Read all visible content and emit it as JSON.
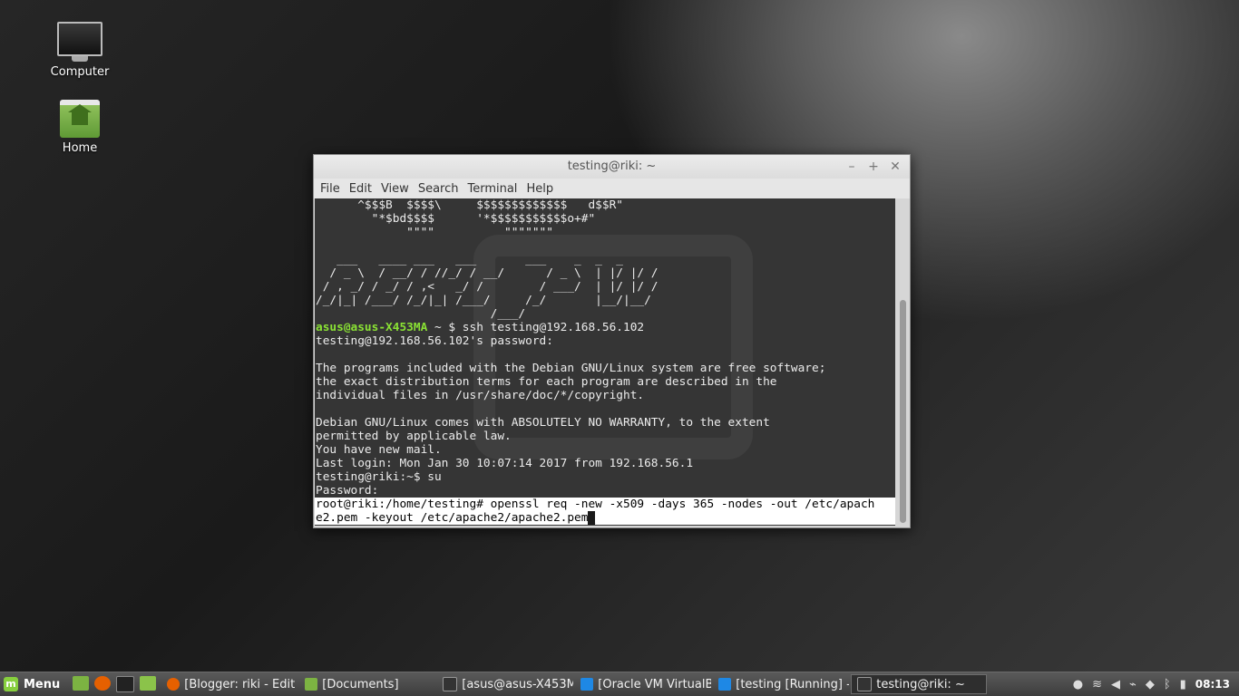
{
  "desktop": {
    "icons": [
      {
        "label": "Computer",
        "icon": "computer-icon"
      },
      {
        "label": "Home",
        "icon": "home-folder-icon"
      }
    ]
  },
  "window": {
    "title": "testing@riki: ~",
    "buttons": {
      "minimize": "–",
      "maximize": "+",
      "close": "✕"
    },
    "menu": [
      "File",
      "Edit",
      "View",
      "Search",
      "Terminal",
      "Help"
    ]
  },
  "terminal": {
    "lines": [
      "      ^$$$B  $$$$\\     $$$$$$$$$$$$$   d$$R\"",
      "        \"*$bd$$$$      '*$$$$$$$$$$$o+#\"",
      "             \"\"\"\"          \"\"\"\"\"\"\"",
      "",
      "   ___   ____ ___   ___       ___    _  _  _",
      "  / _ \\  / __/ / //_/ / __/      / _ \\  | |/ |/ /",
      " / , _/ / _/ / ,<   _/ /        / ___/  | |/ |/ /",
      "/_/|_| /___/ /_/|_| /___/     /_/       |__/|__/",
      "                         /___/"
    ],
    "prompt_user": "asus@asus-X453MA",
    "prompt_rest": " ~ $ ssh testing@192.168.56.102",
    "output": [
      "testing@192.168.56.102's password:",
      "",
      "The programs included with the Debian GNU/Linux system are free software;",
      "the exact distribution terms for each program are described in the",
      "individual files in /usr/share/doc/*/copyright.",
      "",
      "Debian GNU/Linux comes with ABSOLUTELY NO WARRANTY, to the extent",
      "permitted by applicable law.",
      "You have new mail.",
      "Last login: Mon Jan 30 10:07:14 2017 from 192.168.56.1",
      "testing@riki:~$ su",
      "Password:"
    ],
    "command_line1": "root@riki:/home/testing# openssl req -new -x509 -days 365 -nodes -out /etc/apach",
    "command_line2": "e2.pem -keyout /etc/apache2/apache2.pem"
  },
  "taskbar": {
    "menu_label": "Menu",
    "tasks": [
      {
        "label": "[Blogger: riki - Edit e...",
        "icon": "firefox-icon",
        "color": "#e66000"
      },
      {
        "label": "[Documents]",
        "icon": "folder-icon",
        "color": "#7cb342"
      },
      {
        "label": "[asus@asus-X453M...",
        "icon": "terminal-icon",
        "color": "#333333"
      },
      {
        "label": "[Oracle VM VirtualB...",
        "icon": "virtualbox-icon",
        "color": "#1e88e5"
      },
      {
        "label": "[testing [Running] - ...",
        "icon": "virtualbox-icon",
        "color": "#1e88e5"
      },
      {
        "label": "testing@riki: ~",
        "icon": "terminal-icon",
        "color": "#333333"
      }
    ],
    "clock": "08:13"
  }
}
